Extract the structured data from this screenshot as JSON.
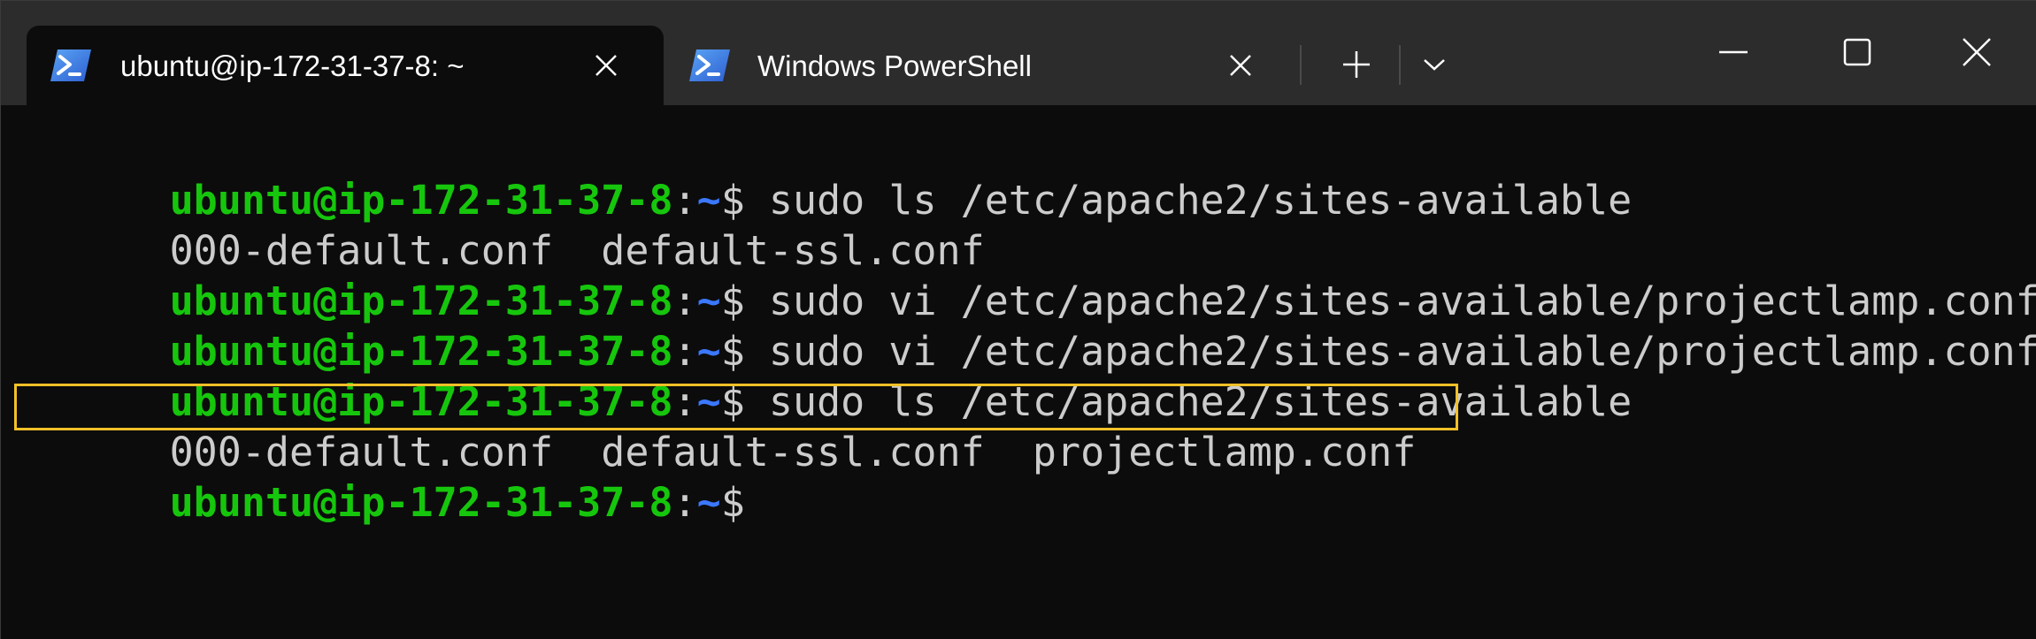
{
  "tabs": [
    {
      "title": "ubuntu@ip-172-31-37-8: ~",
      "icon": "powershell-icon",
      "active": true
    },
    {
      "title": "Windows PowerShell",
      "icon": "powershell-icon",
      "active": false
    }
  ],
  "controls": {
    "new_tab": "plus-icon",
    "dropdown": "chevron-down-icon",
    "minimize": "minimize-icon",
    "maximize": "maximize-icon",
    "close": "close-icon"
  },
  "colors": {
    "prompt_user": "#16c60c",
    "prompt_path": "#3b78ff",
    "text": "#cccccc",
    "background": "#0c0c0c",
    "highlight_border": "#f0c028"
  },
  "terminal": {
    "lines": [
      {
        "type": "prompt",
        "user": "ubuntu@ip-172-31-37-8",
        "colon": ":",
        "path": "~",
        "dollar": "$",
        "command": " sudo ls /etc/apache2/sites-available"
      },
      {
        "type": "output",
        "text": "000-default.conf  default-ssl.conf"
      },
      {
        "type": "prompt",
        "user": "ubuntu@ip-172-31-37-8",
        "colon": ":",
        "path": "~",
        "dollar": "$",
        "command": " sudo vi /etc/apache2/sites-available/projectlamp.conf"
      },
      {
        "type": "prompt",
        "user": "ubuntu@ip-172-31-37-8",
        "colon": ":",
        "path": "~",
        "dollar": "$",
        "command": " sudo vi /etc/apache2/sites-available/projectlamp.conf"
      },
      {
        "type": "prompt",
        "user": "ubuntu@ip-172-31-37-8",
        "colon": ":",
        "path": "~",
        "dollar": "$",
        "command": " sudo ls /etc/apache2/sites-available"
      },
      {
        "type": "output",
        "text": "000-default.conf  default-ssl.conf  projectlamp.conf"
      },
      {
        "type": "prompt",
        "user": "ubuntu@ip-172-31-37-8",
        "colon": ":",
        "path": "~",
        "dollar": "$",
        "command": ""
      }
    ]
  }
}
